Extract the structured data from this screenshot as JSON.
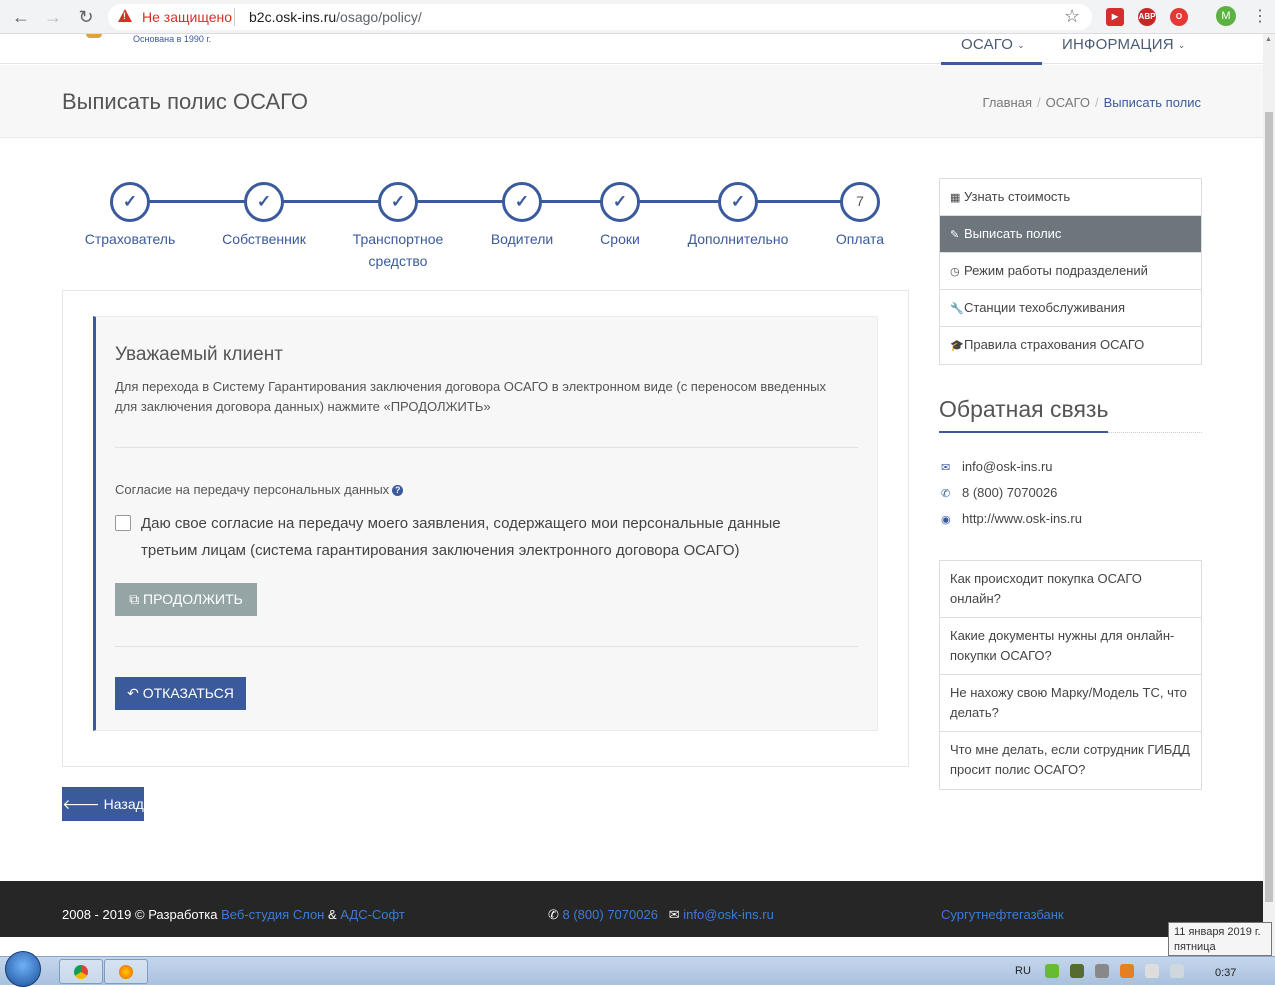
{
  "browser": {
    "not_secure": "Не защищено",
    "url_host": "b2c.osk-ins.ru",
    "url_path": "/osago/policy/",
    "profile_initial": "M"
  },
  "header": {
    "logo_sub": "Основана в 1990 г.",
    "nav": [
      "ОСАГО",
      "ИНФОРМАЦИЯ"
    ]
  },
  "title_band": {
    "title": "Выписать полис ОСАГО",
    "breadcrumb": [
      "Главная",
      "ОСАГО",
      "Выписать полис"
    ]
  },
  "stepper": {
    "steps": [
      "Страхователь",
      "Собственник",
      "Транспортное средство",
      "Водители",
      "Сроки",
      "Дополнительно",
      "Оплата"
    ],
    "last_number": "7"
  },
  "panel": {
    "heading": "Уважаемый клиент",
    "text": "Для перехода в Систему Гарантирования заключения договора ОСАГО в электронном виде (с переносом введенных для заключения договора данных) нажмите «ПРОДОЛЖИТЬ»",
    "consent_label": "Согласие на передачу персональных данных",
    "consent_text": "Даю свое согласие на передачу моего заявления, содержащего мои персональные данные третьим лицам (система гарантирования заключения электронного договора ОСАГО)",
    "consent_checked": false,
    "continue_label": "ПРОДОЛЖИТЬ",
    "refuse_label": "ОТКАЗАТЬСЯ",
    "back_label": "Назад"
  },
  "sidebar": {
    "menu": [
      {
        "label": "Узнать стоимость",
        "icon": "calculator-icon",
        "active": false
      },
      {
        "label": "Выписать полис",
        "icon": "edit-icon",
        "active": true
      },
      {
        "label": "Режим работы подразделений",
        "icon": "clock-icon",
        "active": false
      },
      {
        "label": "Станции техобслуживания",
        "icon": "wrench-icon",
        "active": false
      },
      {
        "label": "Правила страхования ОСАГО",
        "icon": "graduation-cap-icon",
        "active": false
      }
    ],
    "feedback_title": "Обратная связь",
    "contacts": {
      "email": "info@osk-ins.ru",
      "phone": "8 (800) 7070026",
      "site": "http://www.osk-ins.ru"
    },
    "faq": [
      "Как происходит покупка ОСАГО онлайн?",
      "Какие документы нужны для онлайн-покупки ОСАГО?",
      "Не нахожу свою Марку/Модель ТС, что делать?",
      "Что мне делать, если сотрудник ГИБДД просит полис ОСАГО?"
    ]
  },
  "footer": {
    "copy": "2008 - 2019 © Разработка",
    "dev1": "Веб-студия Слон",
    "amp": "&",
    "dev2": "АДС-Софт",
    "phone": "8 (800) 7070026",
    "email": "info@osk-ins.ru",
    "bank": "Сургутнефтегазбанк"
  },
  "taskbar": {
    "lang": "RU",
    "time": "0:37",
    "date_line1": "11 января 2019 г.",
    "date_line2": "пятница"
  },
  "colors": {
    "accent": "#3a5a9c",
    "sidebar_active": "#6d757d",
    "continue_disabled": "#95a5a6",
    "footer_bg": "#262626"
  }
}
